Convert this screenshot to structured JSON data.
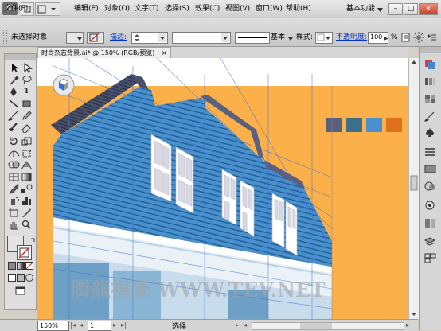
{
  "app": {
    "logo": "Ai"
  },
  "menubar": {
    "items": [
      "文件(F)",
      "编辑(E)",
      "对象(O)",
      "文字(T)",
      "选择(S)",
      "效果(C)",
      "视图(V)",
      "窗口(W)",
      "帮助(H)"
    ],
    "workspace": "基本功能",
    "window_buttons": [
      "–",
      "□",
      "×"
    ]
  },
  "control_bar": {
    "selection_label": "未选择对象",
    "stroke_label": "描边:",
    "stroke_style": "基本",
    "style_label": "样式:",
    "opacity_label": "不透明度:",
    "opacity_value": "100",
    "percent": "%"
  },
  "document": {
    "tab_title": "时尚杂志背景.ai* @ 150% (RGB/预览)"
  },
  "swatches": [
    "#5a5f7e",
    "#3b6f8a",
    "#4b8fcc",
    "#e0711c"
  ],
  "canvas": {
    "bg_color": "#fbb04a",
    "watermark": "腾龍視覺 WWW.TEV.NET"
  },
  "status": {
    "zoom": "150%",
    "page": "1",
    "selection": "选择"
  }
}
